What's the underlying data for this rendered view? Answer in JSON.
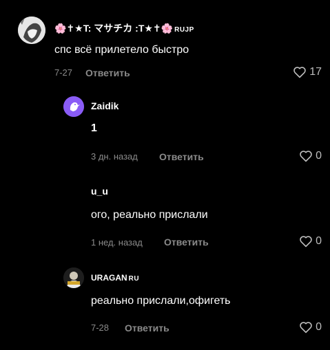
{
  "comments": [
    {
      "name": "🌸✝★T: マサチカ :T★✝🌸",
      "badge": "RUJP",
      "text": "спс всё прилетело быстро",
      "date": "7-27",
      "reply_label": "Ответить",
      "likes": "17"
    },
    {
      "name": "Zaidik",
      "badge": "",
      "text": "1",
      "date": "3 дн. назад",
      "reply_label": "Ответить",
      "likes": "0"
    },
    {
      "name": "u_u",
      "badge": "",
      "text": "ого, реально прислали",
      "date": "1 нед. назад",
      "reply_label": "Ответить",
      "likes": "0"
    },
    {
      "name": "URAGAN",
      "badge": "RU",
      "text": "реально прислали,офигеть",
      "date": "7-28",
      "reply_label": "Ответить",
      "likes": "0"
    }
  ],
  "colors": {
    "background": "#000000",
    "secondary_text": "#8a8a8a",
    "avatar_purple": "#8a5cf6"
  },
  "icons": [
    "heart-icon",
    "user-avatar",
    "bird-icon"
  ]
}
